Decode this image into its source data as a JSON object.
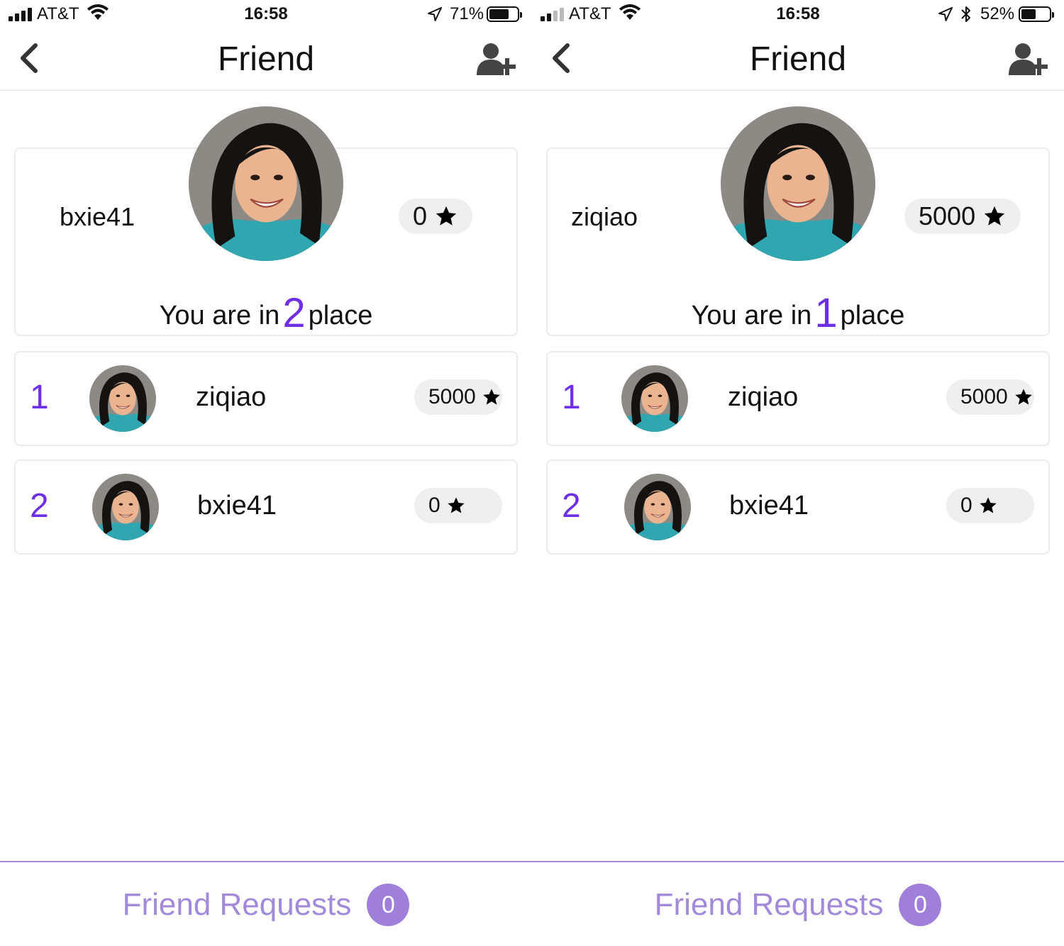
{
  "screens": [
    {
      "status": {
        "carrier": "AT&T",
        "time": "16:58",
        "battery_pct": "71%",
        "battery_level": 0.71,
        "bluetooth": false
      },
      "nav": {
        "title": "Friend",
        "back_icon": "chevron-left-icon",
        "add_icon": "add-friend-icon"
      },
      "me": {
        "name": "bxie41",
        "stars": "0",
        "place_prefix": "You are in",
        "place_num": "2",
        "place_suffix": "place"
      },
      "rows": [
        {
          "rank": "1",
          "name": "ziqiao",
          "stars": "5000"
        },
        {
          "rank": "2",
          "name": "bxie41",
          "stars": "0"
        }
      ],
      "footer": {
        "requests_label": "Friend Requests",
        "requests_count": "0"
      }
    },
    {
      "status": {
        "carrier": "AT&T",
        "time": "16:58",
        "battery_pct": "52%",
        "battery_level": 0.52,
        "bluetooth": true
      },
      "nav": {
        "title": "Friend",
        "back_icon": "chevron-left-icon",
        "add_icon": "add-friend-icon"
      },
      "me": {
        "name": "ziqiao",
        "stars": "5000",
        "place_prefix": "You are in",
        "place_num": "1",
        "place_suffix": "place"
      },
      "rows": [
        {
          "rank": "1",
          "name": "ziqiao",
          "stars": "5000"
        },
        {
          "rank": "2",
          "name": "bxie41",
          "stars": "0"
        }
      ],
      "footer": {
        "requests_label": "Friend Requests",
        "requests_count": "0"
      }
    }
  ],
  "colors": {
    "accent": "#6f2fe6",
    "star": "#b9a6e8",
    "footer_text": "#a08ad9",
    "badge": "#9f7fda"
  }
}
